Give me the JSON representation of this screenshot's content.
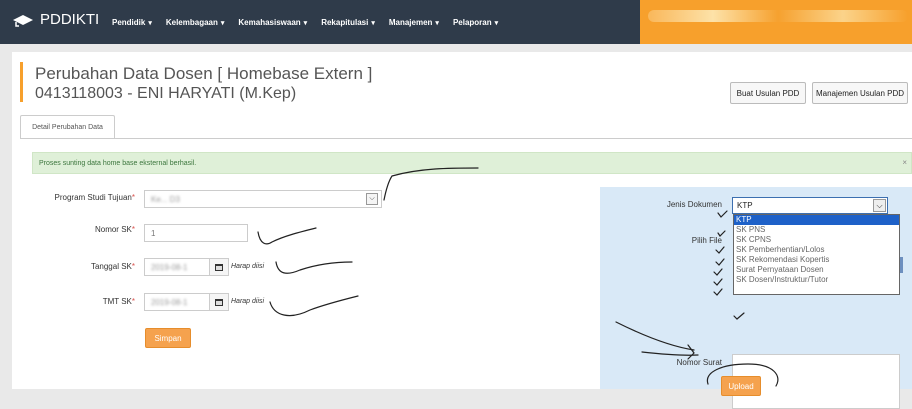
{
  "brand": {
    "name": "PDDIKTI",
    "icon": "graduation-logo-icon"
  },
  "nav": {
    "items": [
      {
        "label": "Pendidik"
      },
      {
        "label": "Kelembagaan"
      },
      {
        "label": "Kemahasiswaan"
      },
      {
        "label": "Rekapitulasi"
      },
      {
        "label": "Manajemen"
      },
      {
        "label": "Pelaporan"
      }
    ],
    "caret": "▾"
  },
  "page": {
    "title": "Perubahan Data Dosen [ Homebase Extern ]",
    "subtitle": "0413118003 - ENI HARYATI (M.Kep)",
    "buttons": {
      "buat_usulan": "Buat Usulan PDD",
      "manajemen_usulan": "Manajemen Usulan PDD"
    },
    "tab": "Detail Perubahan Data",
    "alert": "Proses sunting data home base eksternal berhasil.",
    "alert_close": "×"
  },
  "form": {
    "program_studi": {
      "label": "Program Studi Tujuan",
      "value": "Ke...  D3"
    },
    "nomor_sk": {
      "label": "Nomor SK",
      "value": "1"
    },
    "tanggal_sk": {
      "label": "Tanggal SK",
      "value": "2019-08-1",
      "hint": "Harap diisi"
    },
    "tmt_sk": {
      "label": "TMT SK",
      "value": "2019-08-1",
      "hint": "Harap diisi"
    },
    "required_mark": "*",
    "submit": "Simpan"
  },
  "upload": {
    "jenis_label": "Jenis Dokumen",
    "jenis_value": "KTP",
    "options": [
      "KTP",
      "SK PNS",
      "SK CPNS",
      "SK Pemberhentian/Lolos",
      "SK Rekomendasi Kopertis",
      "Surat Pernyataan Dosen",
      "SK Dosen/Instruktur/Tutor"
    ],
    "pilih_label": "Pilih File",
    "nomor_label": "Nomor Surat",
    "button": "Upload"
  },
  "colors": {
    "navbar": "#2f3b4a",
    "accent": "#f7a02c",
    "button": "#f5a24e",
    "alert_bg": "#dff0d8",
    "panel_bg": "#d9e9f7"
  }
}
